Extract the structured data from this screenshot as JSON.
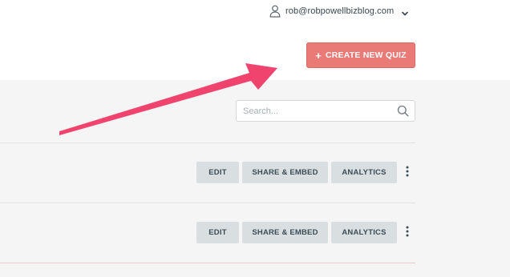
{
  "account": {
    "email": "rob@robpowellbizblog.com",
    "icon": "user-icon",
    "menu_icon": "chevron-down-icon"
  },
  "header": {
    "create_button": {
      "plus": "+",
      "label": "CREATE NEW QUIZ",
      "color": "#ea7a76"
    }
  },
  "search": {
    "placeholder": "Search...",
    "value": "",
    "icon": "search-icon"
  },
  "quiz_rows": [
    {
      "edit_label": "EDIT",
      "share_label": "SHARE & EMBED",
      "analytics_label": "ANALYTICS",
      "menu_icon": "more-vertical-icon"
    },
    {
      "edit_label": "EDIT",
      "share_label": "SHARE & EMBED",
      "analytics_label": "ANALYTICS",
      "menu_icon": "more-vertical-icon"
    }
  ],
  "annotation": {
    "arrow_color": "#f0446f",
    "points_to": "create-new-quiz-button"
  },
  "colors": {
    "page_background": "#f4f5f4",
    "header_background": "#ffffff",
    "action_button": "#d9dfe0"
  }
}
